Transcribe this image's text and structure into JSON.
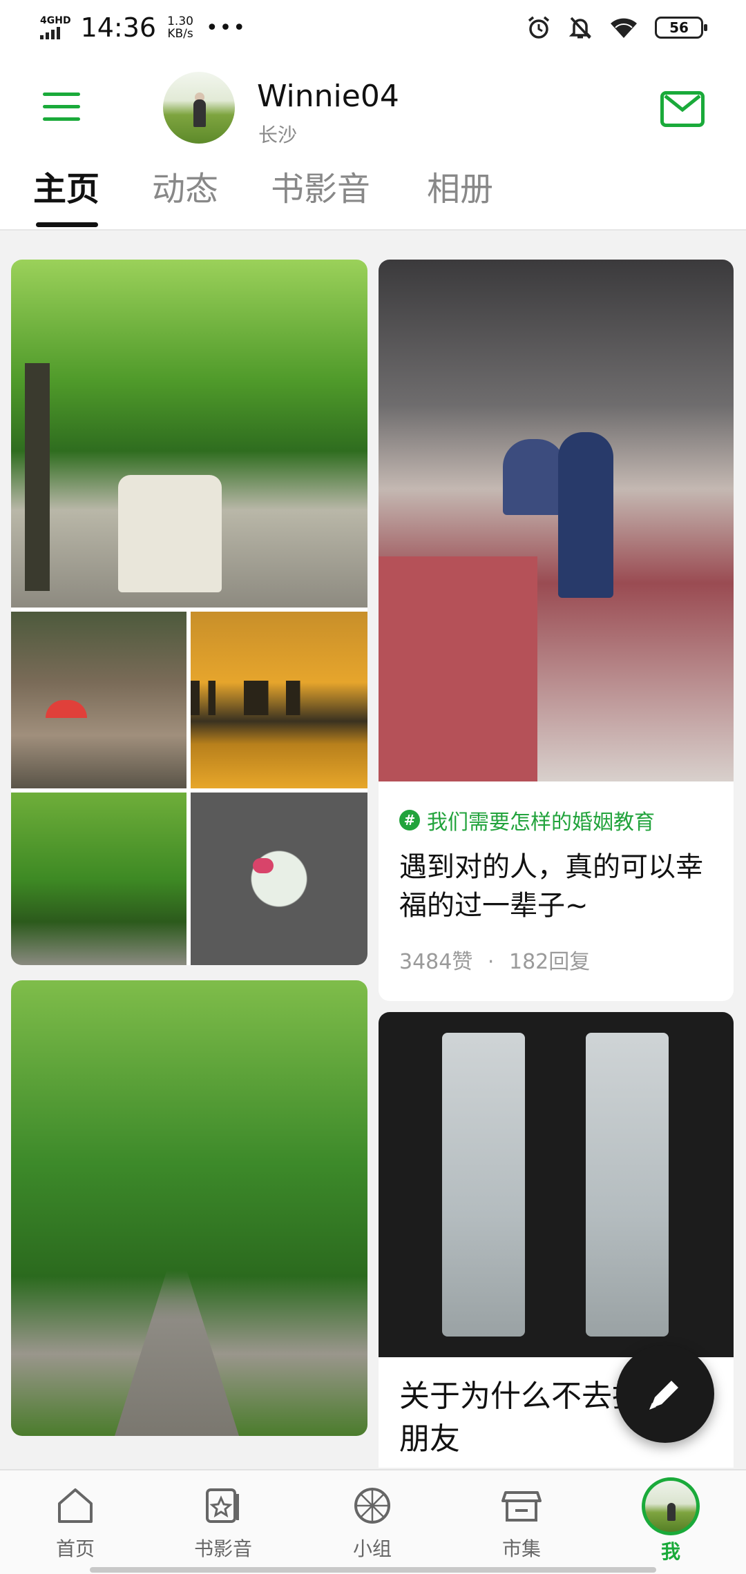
{
  "status_bar": {
    "network": "4GHD",
    "time": "14:36",
    "speed_value": "1.30",
    "speed_unit": "KB/s",
    "more": "•••",
    "battery": "56",
    "icons": [
      "alarm-icon",
      "mute-bell-icon",
      "wifi-icon",
      "battery-icon"
    ]
  },
  "profile": {
    "username": "Winnie04",
    "city": "长沙"
  },
  "tabs": [
    {
      "label": "主页",
      "active": true
    },
    {
      "label": "动态",
      "active": false
    },
    {
      "label": "书影音",
      "active": false
    },
    {
      "label": "相册",
      "active": false
    }
  ],
  "feed": {
    "post1": {
      "topic": "我们需要怎样的婚姻教育",
      "title": "遇到对的人，真的可以幸福的过一辈子~",
      "likes": "3484赞",
      "separator": "·",
      "replies": "182回复"
    },
    "post2": {
      "title": "关于为什么不去找朋友"
    }
  },
  "bottom_nav": [
    {
      "label": "首页",
      "icon": "home-icon"
    },
    {
      "label": "书影音",
      "icon": "star-cards-icon"
    },
    {
      "label": "小组",
      "icon": "group-icon"
    },
    {
      "label": "市集",
      "icon": "market-icon"
    },
    {
      "label": "我",
      "icon": "avatar",
      "active": true
    }
  ],
  "colors": {
    "accent": "#1aaa3a",
    "topic_green": "#22a33c",
    "background": "#f2f2f2"
  }
}
